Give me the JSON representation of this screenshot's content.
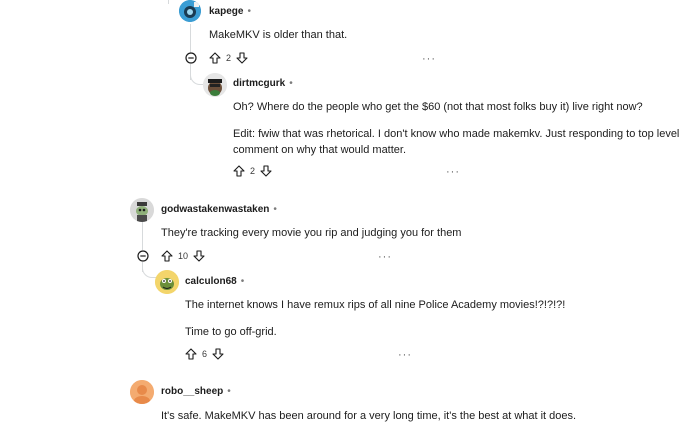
{
  "comments": [
    {
      "username": "kapege",
      "text_lines": [
        "MakeMKV is older than that."
      ],
      "votes": "2"
    },
    {
      "username": "dirtmcgurk",
      "text_lines": [
        "Oh? Where do the people who get the $60 (not that most folks buy it) live right now?",
        "Edit: fwiw that was rhetorical. I don't know who made makemkv. Just responding to top level",
        "comment on why that would matter."
      ],
      "votes": "2"
    },
    {
      "username": "godwastakenwastaken",
      "text_lines": [
        "They're tracking every movie you rip and judging you for them"
      ],
      "votes": "10"
    },
    {
      "username": "calculon68",
      "text_lines": [
        "The internet knows I have remux rips of all nine Police Academy movies!?!?!?!",
        "Time to go off-grid."
      ],
      "votes": "6"
    },
    {
      "username": "robo__sheep",
      "text_lines": [
        "It's safe. MakeMKV has been around for a very long time, it's the best at what it does."
      ]
    }
  ],
  "separator": "•",
  "more_label": "···",
  "colors": {
    "thread_line": "#d7dadc",
    "text": "#1c1c1c",
    "meta": "#7c7c7c"
  }
}
